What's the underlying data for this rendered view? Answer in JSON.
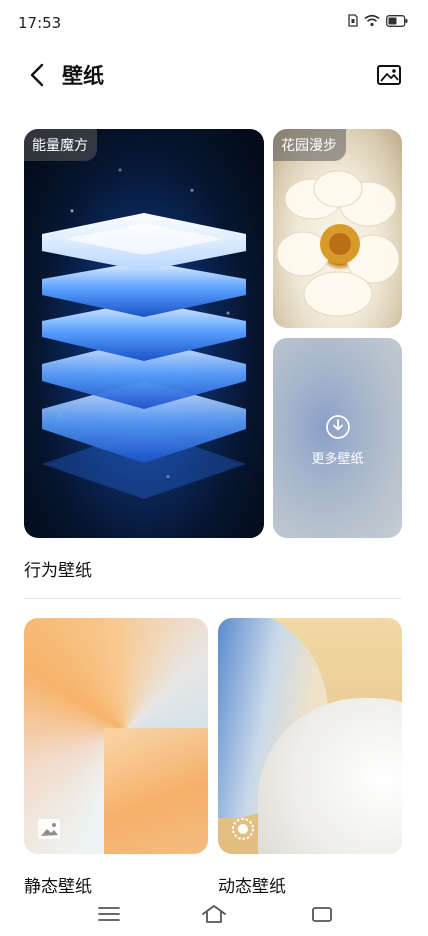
{
  "status_bar": {
    "time": "17:53"
  },
  "header": {
    "title": "壁纸"
  },
  "wallpapers": {
    "featured": {
      "tag": "能量魔方"
    },
    "garden": {
      "tag": "花园漫步"
    },
    "more": {
      "label": "更多壁纸"
    }
  },
  "sections": {
    "behavior": {
      "label": "行为壁纸"
    },
    "static": {
      "label": "静态壁纸"
    },
    "dynamic": {
      "label": "动态壁纸"
    }
  },
  "colors": {
    "accent_blue": "#2f7ff0",
    "text_primary": "#111111"
  }
}
